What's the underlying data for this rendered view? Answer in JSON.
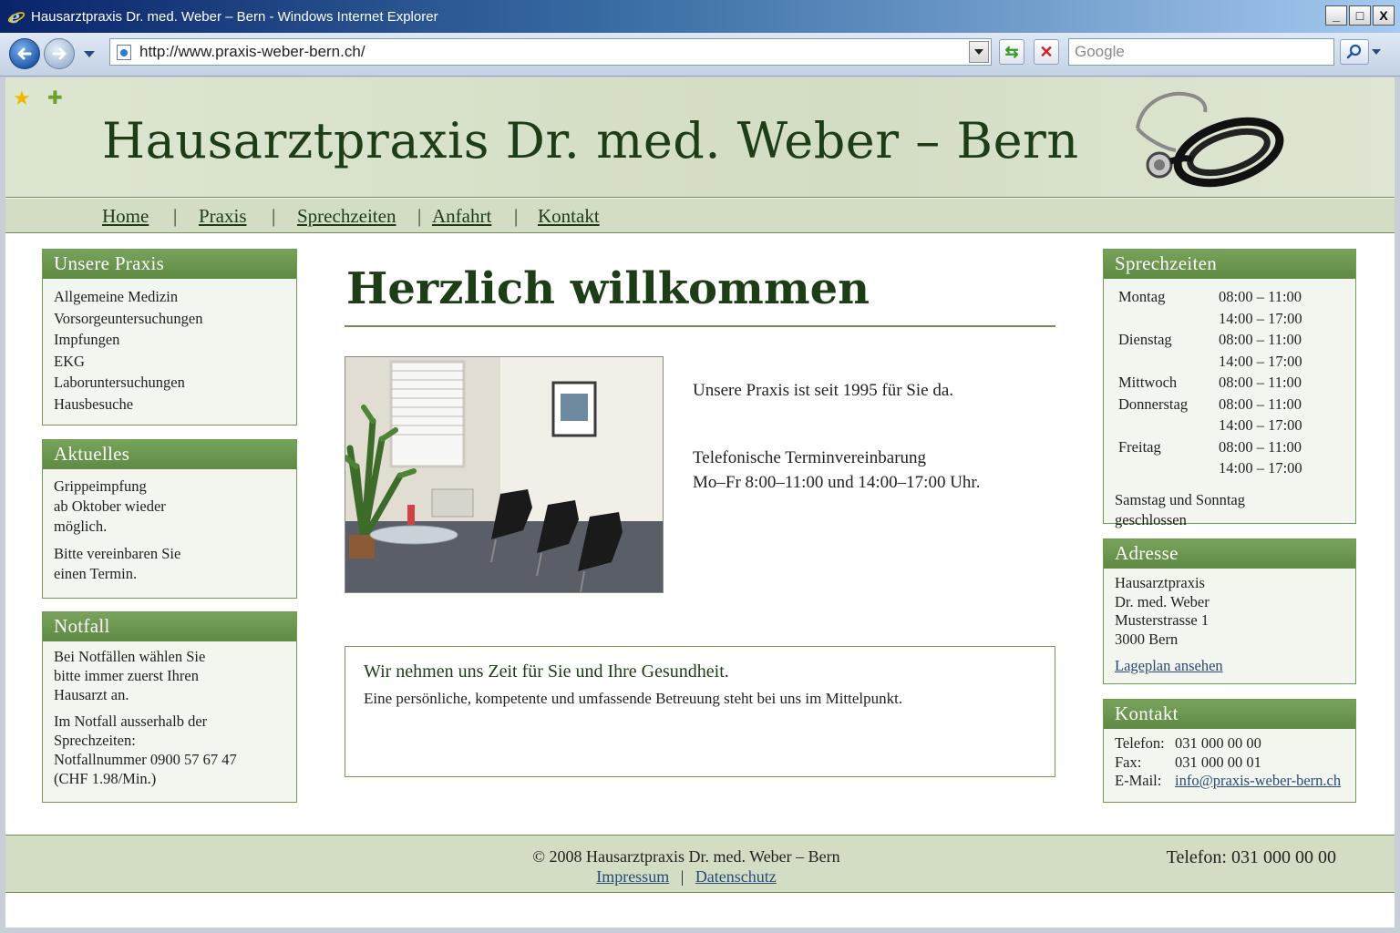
{
  "window": {
    "title": "Hausarztpraxis Dr. med. Weber – Bern - Windows Internet Explorer",
    "minimize": "_",
    "maximize": "□",
    "close": "X"
  },
  "toolbar": {
    "url": "http://www.praxis-weber-bern.ch/",
    "search_placeholder": "Google"
  },
  "header": {
    "title": "Hausarztpraxis  Dr. med. Weber – Bern"
  },
  "nav": {
    "items": [
      "Home",
      "Praxis",
      "Sprechzeiten",
      "Anfahrt",
      "Kontakt"
    ],
    "separator": "|"
  },
  "left": {
    "praxis": {
      "title": "Unsere Praxis",
      "items": [
        "Allgemeine Medizin",
        "Vorsorgeuntersuchungen",
        "Impfungen",
        "EKG",
        "Laboruntersuchungen",
        "Hausbesuche"
      ]
    },
    "aktuelles": {
      "title": "Aktuelles",
      "p1_l1": "Grippeimpfung",
      "p1_l2": "ab Oktober wieder",
      "p1_l3": "möglich.",
      "p2_l1": "Bitte vereinbaren Sie",
      "p2_l2": "einen Termin."
    },
    "notfall": {
      "title": "Notfall",
      "p1_l1": "Bei Notfällen wählen Sie",
      "p1_l2": "bitte immer zuerst Ihren",
      "p1_l3": "Hausarzt an.",
      "p2_l1": "Im Notfall ausserhalb der",
      "p2_l2": "Sprechzeiten:",
      "p2_l3": "Notfallnummer 0900 57 67 47",
      "p2_l4": "(CHF 1.98/Min.)"
    }
  },
  "main": {
    "heading": "Herzlich willkommen",
    "intro1": "Unsere Praxis ist seit 1995 für Sie da.",
    "intro2_l1": "Telefonische Terminvereinbarung",
    "intro2_l2": "Mo–Fr 8:00–11:00 und 14:00–17:00 Uhr.",
    "callout_title": "Wir nehmen uns Zeit für Sie und Ihre Gesundheit.",
    "callout_text": "Eine persönliche, kompetente und umfassende Betreuung steht bei uns im Mittelpunkt."
  },
  "right": {
    "sprechzeiten": {
      "title": "Sprechzeiten",
      "rows": [
        {
          "day": "Montag",
          "time": " 08:00 – 11:00"
        },
        {
          "day": "",
          "time": " 14:00 – 17:00"
        },
        {
          "day": "Dienstag",
          "time": "08:00 – 11:00"
        },
        {
          "day": "",
          "time": "14:00 – 17:00"
        },
        {
          "day": "Mittwoch",
          "time": "08:00 – 11:00"
        },
        {
          "day": "Donnerstag",
          "time": "08:00 – 11:00"
        },
        {
          "day": "",
          "time": "14:00 – 17:00"
        },
        {
          "day": "Freitag",
          "time": "08:00 – 11:00"
        },
        {
          "day": "",
          "time": "14:00 – 17:00"
        }
      ],
      "weekend_l1": "Samstag und Sonntag",
      "weekend_l2": "geschlossen"
    },
    "adresse": {
      "title": "Adresse",
      "l1": "Hausarztpraxis",
      "l2": "Dr. med. Weber",
      "l3": "Musterstrasse 1",
      "l4": "3000 Bern",
      "link": "Lageplan ansehen"
    },
    "kontakt": {
      "title": "Kontakt",
      "tel_label": "Telefon:",
      "tel": "031 000 00 00",
      "fax_label": "Fax:",
      "fax": "031 000 00 01",
      "mail_label": "E-Mail:",
      "mail": "info@praxis-weber-bern.ch"
    }
  },
  "footer": {
    "copyright": "© 2008 Hausarztpraxis Dr. med. Weber – Bern",
    "impressum": "Impressum",
    "separator": "|",
    "datenschutz": "Datenschutz",
    "phone": "Telefon: 031 000 00 00"
  },
  "colors": {
    "accent": "#6e9b55",
    "header_bg": "#d3ddc3",
    "title_green": "#1d3d16"
  }
}
